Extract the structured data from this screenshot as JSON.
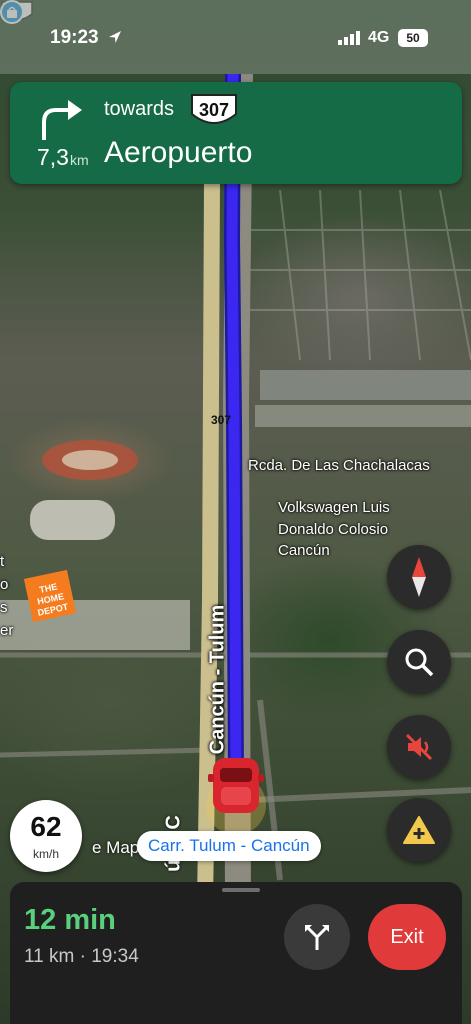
{
  "status_bar": {
    "time": "19:23",
    "network": "4G",
    "battery": "50"
  },
  "banner": {
    "distance": "7,3",
    "distance_unit": "km",
    "towards_label": "towards",
    "route_shield": "307",
    "destination": "Aeropuerto",
    "color": "#146b45"
  },
  "map": {
    "highway_shield": "307",
    "road_name": "Cancún - Tulum",
    "road_name_partial": "ún - C",
    "poi_1": "Rcda. De Las Chachalacas",
    "poi_2_lines": [
      "Volkswagen Luis",
      "Donaldo Colosio",
      "Cancún"
    ],
    "edge_text_lines": [
      "t",
      "o",
      "s",
      "er"
    ],
    "store_logo_lines": [
      "THE",
      "HOME",
      "DEPOT"
    ],
    "route_color": "#2a1fd6"
  },
  "speed": {
    "value": "62",
    "unit": "km/h"
  },
  "watermark": "e Maps",
  "current_road": "Carr. Tulum - Cancún",
  "controls": {
    "compass": "compass-icon",
    "search": "search-icon",
    "mute": "muted-speaker-icon",
    "report": "report-incident-icon"
  },
  "trip": {
    "eta_minutes": "12 min",
    "summary": "11 km · 19:34",
    "exit_label": "Exit",
    "eta_color": "#5bd07c"
  }
}
